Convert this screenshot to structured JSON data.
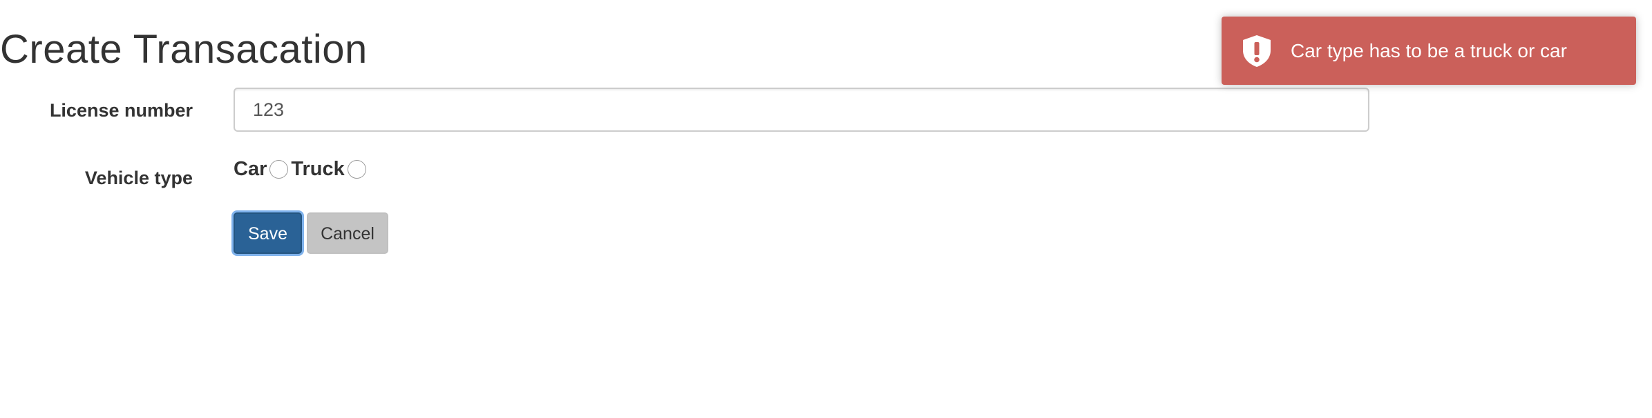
{
  "page": {
    "title": "Create Transacation"
  },
  "form": {
    "license_label": "License number",
    "license_value": "123",
    "vehicle_label": "Vehicle type",
    "vehicle_options": [
      {
        "label": "Car",
        "selected": false
      },
      {
        "label": "Truck",
        "selected": false
      }
    ],
    "save_label": "Save",
    "cancel_label": "Cancel"
  },
  "toast": {
    "message": "Car type has to be a truck or car",
    "icon": "shield-exclamation-icon",
    "background_color": "#cb605a",
    "type": "error"
  },
  "colors": {
    "primary_button": "#2a6296",
    "secondary_button": "#c4c4c4"
  }
}
